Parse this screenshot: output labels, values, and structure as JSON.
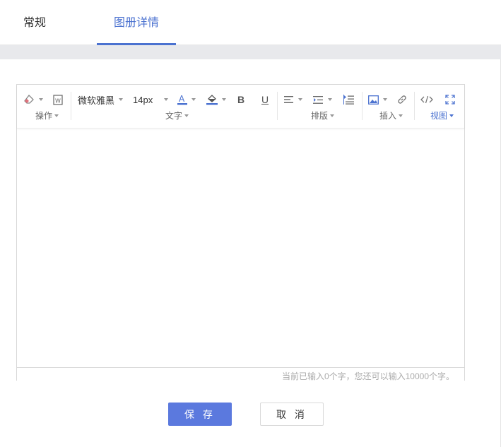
{
  "tabs": {
    "general": "常规",
    "detail": "图册详情",
    "active": "detail"
  },
  "toolbar": {
    "font_family": "微软雅黑",
    "font_size": "14px",
    "bold": "B",
    "underline": "U",
    "groups": {
      "operate": "操作",
      "text": "文字",
      "layout": "排版",
      "insert": "插入",
      "view": "视图"
    }
  },
  "editor": {
    "counter": "当前已输入0个字，您还可以输入10000个字。"
  },
  "actions": {
    "save": "保 存",
    "cancel": "取 消"
  },
  "colors": {
    "accent": "#4b72d0",
    "button": "#5b79de",
    "band": "#e8e9ec"
  }
}
